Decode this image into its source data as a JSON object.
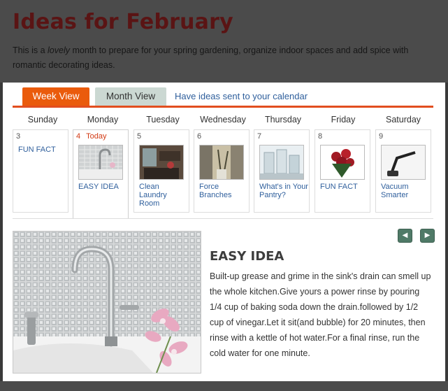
{
  "header": {
    "title": "Ideas for February",
    "intro_before": "This is a ",
    "intro_em": "lovely",
    "intro_after": " month to prepare for your spring gardening, organize indoor spaces and add spice with romantic decorating ideas."
  },
  "tabs": [
    {
      "label": "Week View",
      "active": true
    },
    {
      "label": "Month View",
      "active": false
    }
  ],
  "calendar_link": "Have ideas sent to your calendar",
  "week": [
    {
      "day_name": "Sunday",
      "num": "3",
      "idea": "FUN FACT",
      "has_image": false
    },
    {
      "day_name": "Monday",
      "num": "4",
      "today": "Today",
      "idea": "EASY IDEA",
      "has_image": true
    },
    {
      "day_name": "Tuesday",
      "num": "5",
      "idea": "Clean Laundry Room",
      "has_image": true
    },
    {
      "day_name": "Wednesday",
      "num": "6",
      "idea": "Force Branches",
      "has_image": true
    },
    {
      "day_name": "Thursday",
      "num": "7",
      "idea": "What's in Your Pantry?",
      "has_image": true
    },
    {
      "day_name": "Friday",
      "num": "8",
      "idea": "FUN FACT",
      "has_image": true
    },
    {
      "day_name": "Saturday",
      "num": "9",
      "idea": "Vacuum Smarter",
      "has_image": true
    }
  ],
  "feature": {
    "title": "EASY IDEA",
    "body": "Built-up grease and grime in the sink's drain can smell up the whole kitchen.Give yours a power rinse by pouring 1/4 cup of baking soda down the drain.followed by 1/2 cup of vinegar.Let it sit(and bubble) for 20 minutes, then rinse with a kettle of hot water.For a final rinse, run the cold water for one minute."
  },
  "nav": {
    "prev_icon": "chevron-left-icon",
    "next_icon": "chevron-right-icon"
  },
  "colors": {
    "title": "#5a1414",
    "active_tab": "#ea5b0c",
    "inactive_tab": "#cbd8d2",
    "link": "#2f5f9c",
    "today": "#d23a14",
    "nav_button": "#4f7a67"
  }
}
